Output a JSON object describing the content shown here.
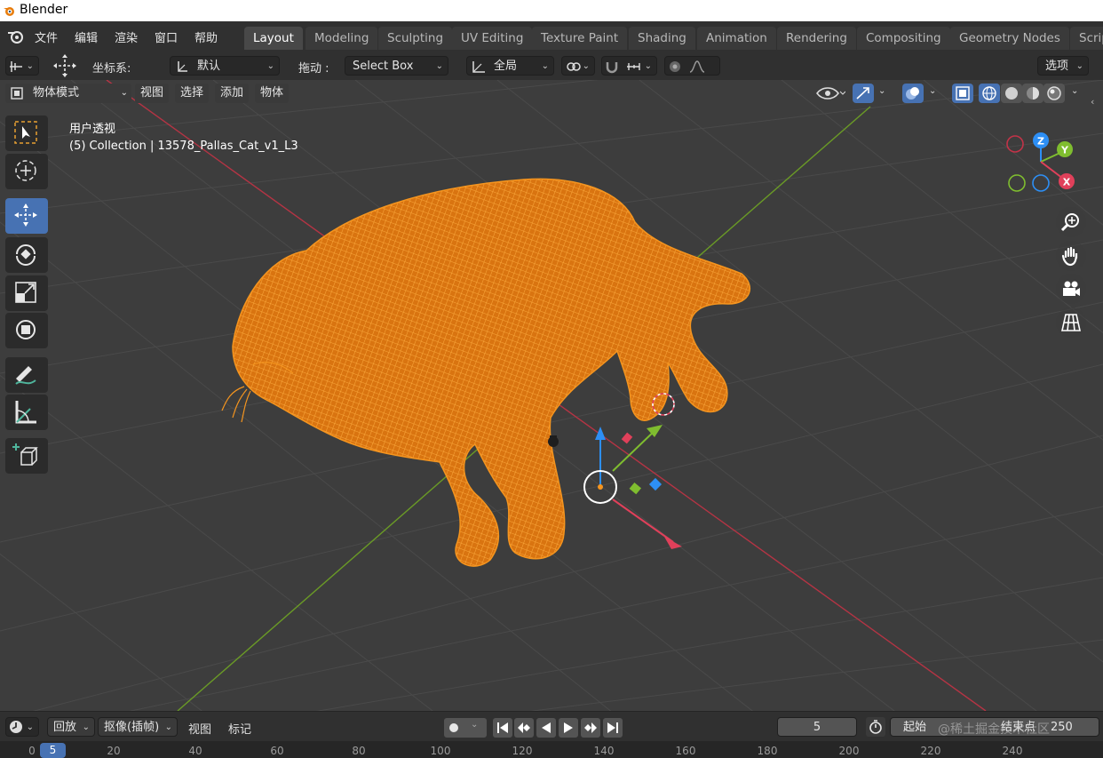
{
  "window": {
    "title": "Blender"
  },
  "menu": [
    "文件",
    "编辑",
    "渲染",
    "窗口",
    "帮助"
  ],
  "workspaces": [
    {
      "label": "Layout",
      "active": true
    },
    {
      "label": "Modeling"
    },
    {
      "label": "Sculpting"
    },
    {
      "label": "UV Editing"
    },
    {
      "label": "Texture Paint"
    },
    {
      "label": "Shading"
    },
    {
      "label": "Animation"
    },
    {
      "label": "Rendering"
    },
    {
      "label": "Compositing"
    },
    {
      "label": "Geometry Nodes"
    },
    {
      "label": "Scrip"
    }
  ],
  "header": {
    "transform_orientation_label": "坐标系:",
    "transform_orientation_value": "默认",
    "drag_label": "拖动 :",
    "drag_value": "Select Box",
    "pivot_value": "全局",
    "options_label": "选项"
  },
  "viewport_header": {
    "mode": "物体模式",
    "menus": [
      "视图",
      "选择",
      "添加",
      "物体"
    ]
  },
  "overlay": {
    "view_name": "用户透视",
    "collection_info": "(5) Collection | 13578_Pallas_Cat_v1_L3"
  },
  "gizmo": {
    "z": "Z",
    "y": "Y",
    "x": "X"
  },
  "timeline": {
    "playback": "回放",
    "keying": "抠像(插帧)",
    "view": "视图",
    "marker": "标记",
    "current_frame": "5",
    "start_label": "起始",
    "end_label": "结束点",
    "end_value": "250",
    "watermark": "@稀土掘金技术社区",
    "ruler_marker": "5",
    "ruler": [
      "0",
      "20",
      "40",
      "60",
      "80",
      "100",
      "120",
      "140",
      "160",
      "180",
      "200",
      "220",
      "240"
    ]
  },
  "colors": {
    "accent": "#4772b3",
    "selection": "#f5951f",
    "x_axis": "#e0405a",
    "y_axis": "#7fbd2f",
    "z_axis": "#2d8ff5"
  }
}
